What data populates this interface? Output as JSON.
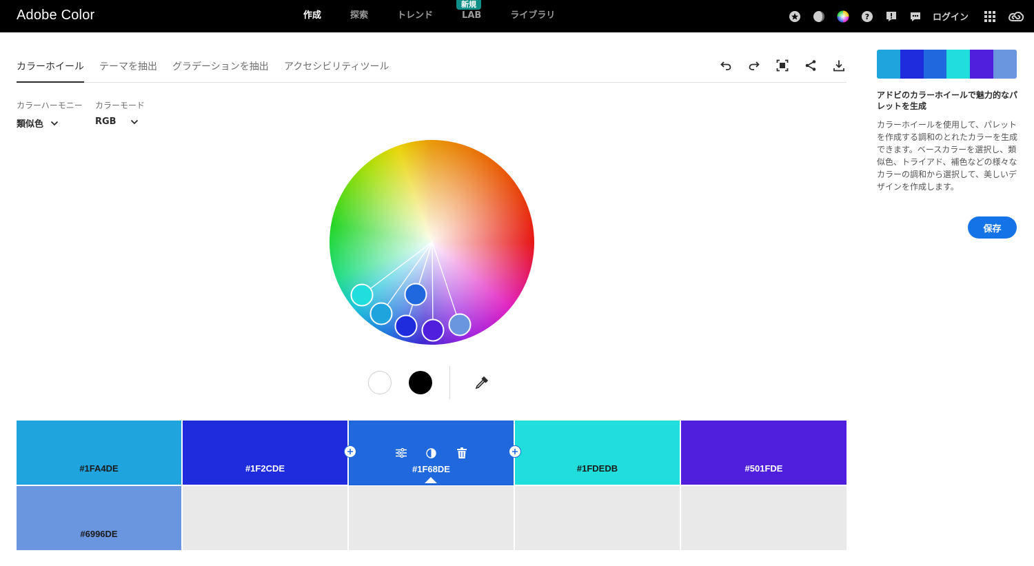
{
  "app": {
    "brand": "Adobe Color"
  },
  "nav": {
    "items": [
      {
        "label": "作成",
        "active": true
      },
      {
        "label": "探索",
        "active": false
      },
      {
        "label": "トレンド",
        "active": false
      },
      {
        "label": "LAB",
        "active": false,
        "badge": "新規"
      },
      {
        "label": "ライブラリ",
        "active": false
      }
    ]
  },
  "topbar": {
    "login": "ログイン",
    "icons": [
      "star-icon",
      "moon-icon",
      "color-wheel-icon",
      "help-icon",
      "feedback-icon",
      "chat-icon",
      "apps-grid-icon",
      "creative-cloud-icon"
    ]
  },
  "tabs": [
    {
      "label": "カラーホイール",
      "active": true
    },
    {
      "label": "テーマを抽出",
      "active": false
    },
    {
      "label": "グラデーションを抽出",
      "active": false
    },
    {
      "label": "アクセシビリティツール",
      "active": false
    }
  ],
  "toolbar": {
    "icons": [
      "undo-icon",
      "redo-icon",
      "fullscreen-icon",
      "share-icon",
      "download-icon"
    ]
  },
  "harmony": {
    "label": "カラーハーモニー",
    "value": "類似色"
  },
  "mode": {
    "label": "カラーモード",
    "value": "RGB"
  },
  "wheel": {
    "handles": [
      {
        "name": "handle-1",
        "color": "#1FDEDB"
      },
      {
        "name": "handle-2",
        "color": "#1FA4DE"
      },
      {
        "name": "handle-3",
        "color": "#1F68DE"
      },
      {
        "name": "handle-4",
        "color": "#1F2CDE"
      },
      {
        "name": "handle-5",
        "color": "#501FDE"
      },
      {
        "name": "handle-6",
        "color": "#6996DE"
      }
    ]
  },
  "swatches": [
    {
      "hex": "#1FA4DE",
      "text_color": "#1a1a1a"
    },
    {
      "hex": "#1F2CDE",
      "text_color": "#ffffff"
    },
    {
      "hex": "#1F68DE",
      "text_color": "#ffffff",
      "selected": true
    },
    {
      "hex": "#1FDEDB",
      "text_color": "#1a1a1a"
    },
    {
      "hex": "#501FDE",
      "text_color": "#ffffff"
    },
    {
      "hex": "#6996DE",
      "text_color": "#1a1a1a"
    }
  ],
  "panel": {
    "title": "アドビのカラーホイールで魅力的なパレットを生成",
    "body": "カラーホイールを使用して、パレットを作成する調和のとれたカラーを生成できます。ベースカラーを選択し、類似色、トライアド、補色などの様々なカラーの調和から選択して、美しいデザインを作成します。",
    "save_label": "保存"
  },
  "colors": {
    "accent": "#1473E6",
    "topbar_bg": "#000000",
    "empty_cell": "#E9E9E9"
  }
}
